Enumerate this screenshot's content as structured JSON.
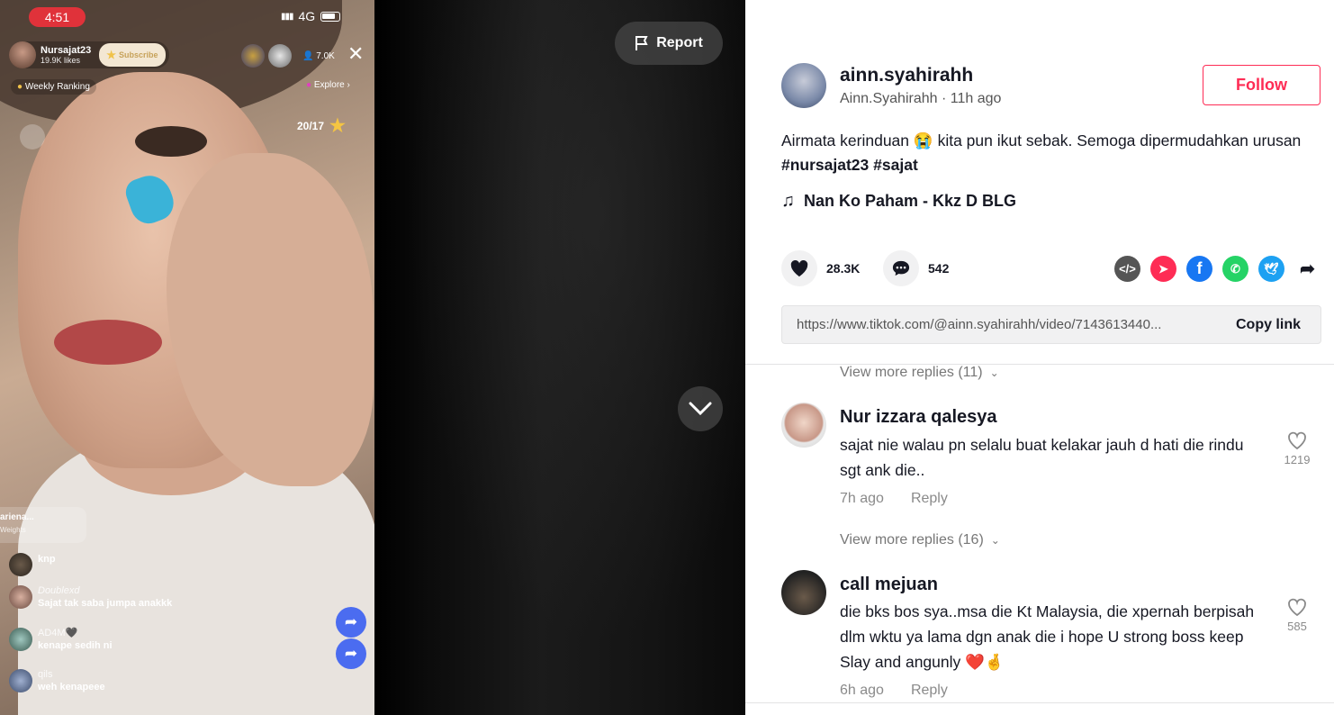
{
  "live": {
    "status_time": "4:51",
    "network": "4G",
    "host_name": "Nursajat23",
    "host_likes": "19.9K likes",
    "subscribe_label": "Subscribe",
    "viewer_count": "7.0K",
    "weekly_ranking": "Weekly Ranking",
    "explore": "Explore ›",
    "progress": "20/17",
    "gift_user": "ariena...",
    "gift_sub": "Weights",
    "comments": [
      {
        "user": "",
        "text": "knp"
      },
      {
        "user": "Doublexd",
        "text": "Sajat tak saba jumpa anakkk"
      },
      {
        "user": "AD4M🖤",
        "text": "kenape sedih ni"
      },
      {
        "user": "qils",
        "text": "weh kenapeee"
      }
    ]
  },
  "report_label": "Report",
  "author": {
    "username": "ainn.syahirahh",
    "display_name": "Ainn.Syahirahh",
    "time_ago": "11h ago",
    "follow_label": "Follow"
  },
  "caption": {
    "text_before": "Airmata kerinduan",
    "text_after": " kita pun ikut sebak. Semoga dipermudahkan urusan",
    "hashtag1": "#nursajat23",
    "hashtag2": "#sajat"
  },
  "music": "Nan Ko Paham - Kkz D BLG",
  "stats": {
    "likes": "28.3K",
    "comments": "542"
  },
  "share_icons": [
    "embed-icon",
    "send-icon",
    "facebook-icon",
    "whatsapp-icon",
    "twitter-icon",
    "share-arrow-icon"
  ],
  "colors": {
    "accent": "#fe2c55",
    "facebook": "#1877f2",
    "whatsapp": "#25d366",
    "twitter": "#1da1f2"
  },
  "link": {
    "url": "https://www.tiktok.com/@ainn.syahirahh/video/7143613440...",
    "copy_label": "Copy link"
  },
  "comments": {
    "view_more_1": "View more replies (11)",
    "items": [
      {
        "name": "Nur izzara qalesya",
        "text": "sajat nie walau pn selalu buat kelakar jauh d hati die rindu sgt ank die..",
        "time": "7h ago",
        "reply": "Reply",
        "likes": "1219",
        "view_more": "View more replies (16)"
      },
      {
        "name": "call mejuan",
        "text": "die bks bos sya..msa die Kt Malaysia, die xpernah berpisah dlm wktu ya lama dgn anak die i hope U strong boss keep Slay and angunly ❤️🤞",
        "time": "6h ago",
        "reply": "Reply",
        "likes": "585"
      }
    ]
  }
}
